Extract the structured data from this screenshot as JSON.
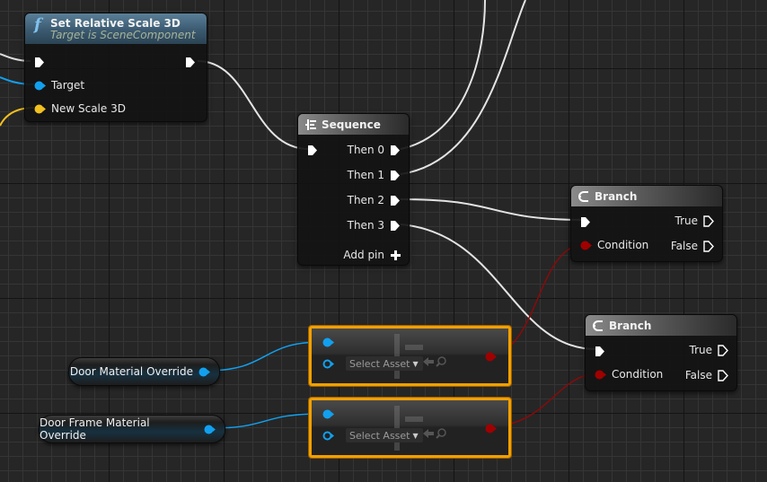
{
  "colors": {
    "exec_wire": "#e8e8e8",
    "object_pin": "#12a0ee",
    "vector_pin": "#f2c020",
    "bool_pin": "#a00000",
    "asset_border": "#f0a000"
  },
  "nodes": {
    "set_relative_scale": {
      "icon": "function-icon",
      "title": "Set Relative Scale 3D",
      "subtitle": "Target is SceneComponent",
      "pins": {
        "target": "Target",
        "new_scale": "New Scale 3D"
      }
    },
    "sequence": {
      "icon": "sequence-icon",
      "title": "Sequence",
      "outputs": [
        "Then 0",
        "Then 1",
        "Then 2",
        "Then 3"
      ],
      "add_pin": "Add pin"
    },
    "branch_1": {
      "icon": "branch-icon",
      "title": "Branch",
      "condition": "Condition",
      "true_label": "True",
      "false_label": "False"
    },
    "branch_2": {
      "icon": "branch-icon",
      "title": "Branch",
      "condition": "Condition",
      "true_label": "True",
      "false_label": "False"
    },
    "asset_node_1": {
      "select_label": "Select Asset"
    },
    "asset_node_2": {
      "select_label": "Select Asset"
    },
    "var_door": {
      "label": "Door Material Override"
    },
    "var_frame": {
      "label": "Door Frame Material Override"
    }
  }
}
